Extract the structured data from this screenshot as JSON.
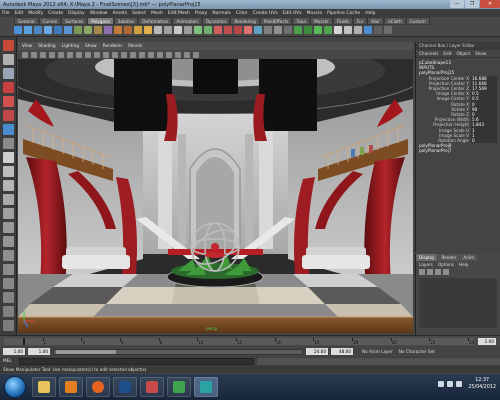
{
  "window": {
    "title": "Autodesk Maya 2012 x64: X:\\Maya 2 - FinalScenes\\[3].mb* --- polyPlanarProj15",
    "controls": [
      "—",
      "❐",
      "✕"
    ]
  },
  "menubar": [
    "File",
    "Edit",
    "Modify",
    "Create",
    "Display",
    "Window",
    "Assets",
    "Select",
    "Mesh",
    "Edit Mesh",
    "Proxy",
    "Normals",
    "Color",
    "Create UVs",
    "Edit UVs",
    "Muscle",
    "Pipeline Cache",
    "Help"
  ],
  "shelf": {
    "tabs": [
      "General",
      "Curves",
      "Surfaces",
      "Polygons",
      "Subdivs",
      "Deformation",
      "Animation",
      "Dynamics",
      "Rendering",
      "PaintEffects",
      "Toon",
      "Muscle",
      "Fluids",
      "Fur",
      "Hair",
      "nCloth",
      "Custom"
    ],
    "active_tab": "Polygons"
  },
  "panel": {
    "menu": [
      "View",
      "Shading",
      "Lighting",
      "Show",
      "Renderer",
      "Panels"
    ],
    "camera_label": "persp"
  },
  "channel_box": {
    "header": "Channel Box / Layer Editor",
    "menu": [
      "Channels",
      "Edit",
      "Object",
      "Show"
    ],
    "object_name": "pCubeShape13",
    "inputs_label": "INPUTS",
    "node": "polyPlanarProj15",
    "attributes": [
      {
        "name": "Projection Center X",
        "value": "16.688"
      },
      {
        "name": "Projection Center Y",
        "value": "11.668"
      },
      {
        "name": "Projection Center Z",
        "value": "17.569"
      },
      {
        "name": "Image Center X",
        "value": "0.5"
      },
      {
        "name": "Image Center Y",
        "value": "0.5"
      },
      {
        "name": "Rotate X",
        "value": "0"
      },
      {
        "name": "Rotate Y",
        "value": "90"
      },
      {
        "name": "Rotate Z",
        "value": "0"
      },
      {
        "name": "Projection Width",
        "value": "5.6"
      },
      {
        "name": "Projection Height",
        "value": "1.843"
      },
      {
        "name": "Image Scale U",
        "value": "1"
      },
      {
        "name": "Image Scale V",
        "value": "1"
      },
      {
        "name": "Rotation Angle",
        "value": "0"
      }
    ],
    "extra_nodes": [
      "polyPlanarProj8",
      "polyPlanarProj7"
    ]
  },
  "layer_editor": {
    "tabs": [
      "Display",
      "Render",
      "Anim"
    ],
    "active_tab": "Display",
    "menu": [
      "Layers",
      "Options",
      "Help"
    ]
  },
  "time_slider": {
    "ticks": [
      "2",
      "4",
      "6",
      "8",
      "10",
      "12",
      "14",
      "16",
      "18",
      "20",
      "22",
      "24"
    ],
    "current_frame": "1.00",
    "current_frame_value": 1,
    "frame_max": 24
  },
  "range_slider": {
    "start": "1.00",
    "start_inner": "1.00",
    "end_inner": "24.00",
    "end": "48.00",
    "anim_layer": "No Anim Layer",
    "char_set": "No Character Set"
  },
  "command_line": {
    "label": "MEL"
  },
  "help_line": "Show Manipulator Tool: Use manipulator(s) to edit selected object(s)",
  "taskbar": {
    "time": "12:37",
    "date": "25/04/2012"
  },
  "colors": {
    "maya_bg": "#444444",
    "viewport_red": "#8e1a1c",
    "highlight": "#6fa8dc"
  }
}
